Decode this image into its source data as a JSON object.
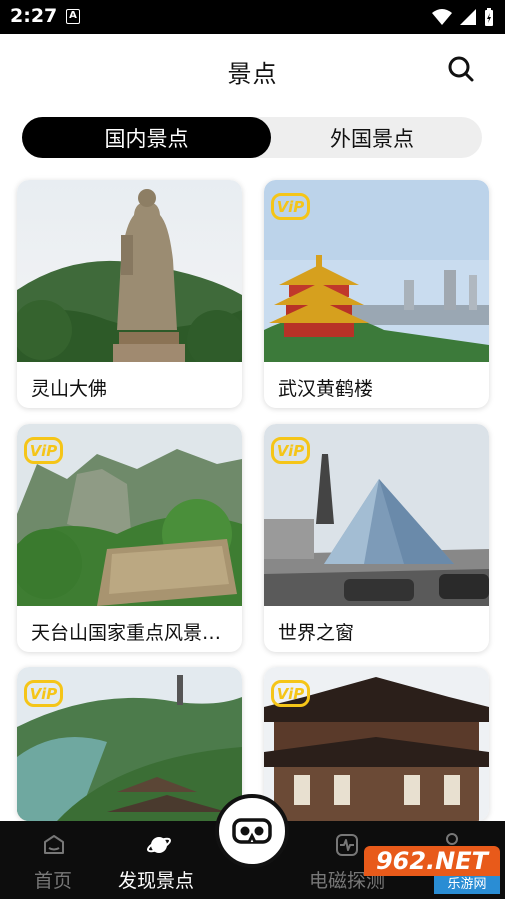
{
  "status": {
    "time": "2:27",
    "a_icon": "A"
  },
  "header": {
    "title": "景点"
  },
  "tabs": {
    "domestic": "国内景点",
    "foreign": "外国景点"
  },
  "cards": [
    {
      "label": "灵山大佛",
      "vip": false
    },
    {
      "label": "武汉黄鹤楼",
      "vip": true
    },
    {
      "label": "天台山国家重点风景名胜区",
      "vip": true
    },
    {
      "label": "世界之窗",
      "vip": true
    },
    {
      "label": "",
      "vip": true
    },
    {
      "label": "",
      "vip": true
    }
  ],
  "vip_text": "ViP",
  "nav": {
    "home": "首页",
    "discover": "发现景点",
    "emf": "电磁探测"
  },
  "watermark": {
    "top": "962.NET",
    "bottom": "乐游网"
  },
  "colors": {
    "accent": "#000000",
    "vip": "#f5c518",
    "nav_bg": "#0d0d0d"
  }
}
